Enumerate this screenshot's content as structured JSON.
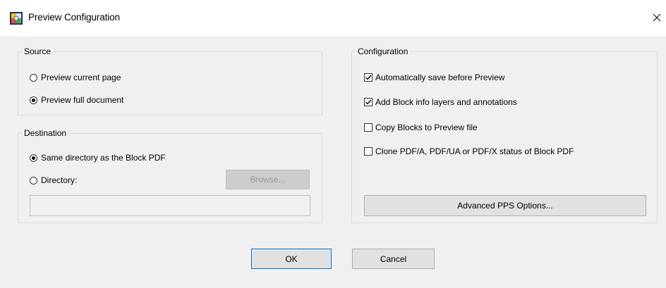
{
  "window": {
    "title": "Preview Configuration",
    "icons": {
      "app": "app-icon",
      "close": "close-icon"
    }
  },
  "source": {
    "legend": "Source",
    "options": [
      {
        "label": "Preview current page",
        "selected": false
      },
      {
        "label": "Preview full document",
        "selected": true
      }
    ]
  },
  "destination": {
    "legend": "Destination",
    "options": [
      {
        "label": "Same directory as the Block PDF",
        "selected": true
      },
      {
        "label": "Directory:",
        "selected": false
      }
    ],
    "browse_label": "Browse...",
    "directory_value": ""
  },
  "configuration": {
    "legend": "Configuration",
    "options": [
      {
        "label": "Automatically save before Preview",
        "checked": true
      },
      {
        "label": "Add Block info layers and annotations",
        "checked": true
      },
      {
        "label": "Copy Blocks to Preview file",
        "checked": false
      },
      {
        "label": "Clone PDF/A, PDF/UA or PDF/X status of Block PDF",
        "checked": false
      }
    ],
    "advanced_label": "Advanced PPS Options..."
  },
  "footer": {
    "ok_label": "OK",
    "cancel_label": "Cancel"
  },
  "colors": {
    "face": "#f0f0f0",
    "accent": "#0078d7"
  }
}
